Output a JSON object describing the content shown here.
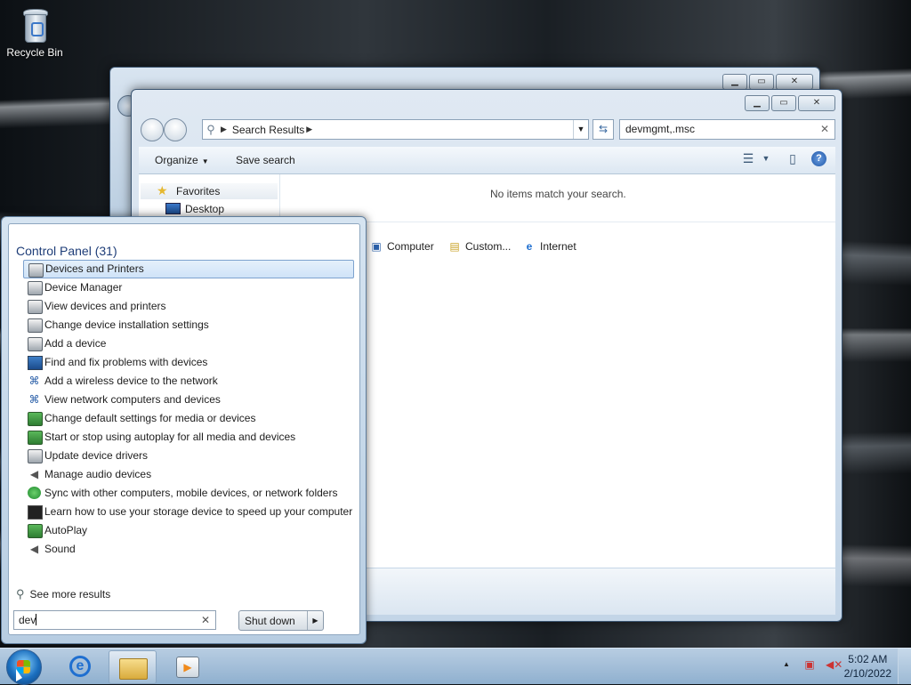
{
  "desktop": {
    "recycle_bin": "Recycle Bin"
  },
  "explorer": {
    "address_crumb": "Search Results",
    "search_value": "devmgmt,.msc",
    "toolbar": {
      "organize": "Organize",
      "save_search": "Save search"
    },
    "nav": {
      "favorites": "Favorites",
      "desktop": "Desktop"
    },
    "no_items": "No items match your search.",
    "colon": ":",
    "search_again_locations": [
      "Computer",
      "Custom...",
      "Internet"
    ]
  },
  "start_menu": {
    "group_header": "Control Panel (31)",
    "items": [
      {
        "label": "Devices and Printers",
        "icon": "printer-icon",
        "selected": true
      },
      {
        "label": "Device Manager",
        "icon": "printer-icon"
      },
      {
        "label": "View devices and printers",
        "icon": "printer-icon"
      },
      {
        "label": "Change device installation settings",
        "icon": "printer-icon"
      },
      {
        "label": "Add a device",
        "icon": "printer-icon"
      },
      {
        "label": "Find and fix problems with devices",
        "icon": "monitor-icon"
      },
      {
        "label": "Add a wireless device to the network",
        "icon": "network-icon"
      },
      {
        "label": "View network computers and devices",
        "icon": "network-icon"
      },
      {
        "label": "Change default settings for media or devices",
        "icon": "media-icon"
      },
      {
        "label": "Start or stop using autoplay for all media and devices",
        "icon": "media-icon"
      },
      {
        "label": "Update device drivers",
        "icon": "printer-icon"
      },
      {
        "label": "Manage audio devices",
        "icon": "speaker-icon"
      },
      {
        "label": "Sync with other computers, mobile devices, or network folders",
        "icon": "sync-icon"
      },
      {
        "label": "Learn how to use your storage device to speed up your computer",
        "icon": "storage-icon"
      },
      {
        "label": "AutoPlay",
        "icon": "media-icon"
      },
      {
        "label": "Sound",
        "icon": "speaker-icon"
      }
    ],
    "see_more": "See more results",
    "search_value": "dev",
    "shutdown": "Shut down"
  },
  "taskbar": {
    "time": "5:02 AM",
    "date": "2/10/2022"
  }
}
